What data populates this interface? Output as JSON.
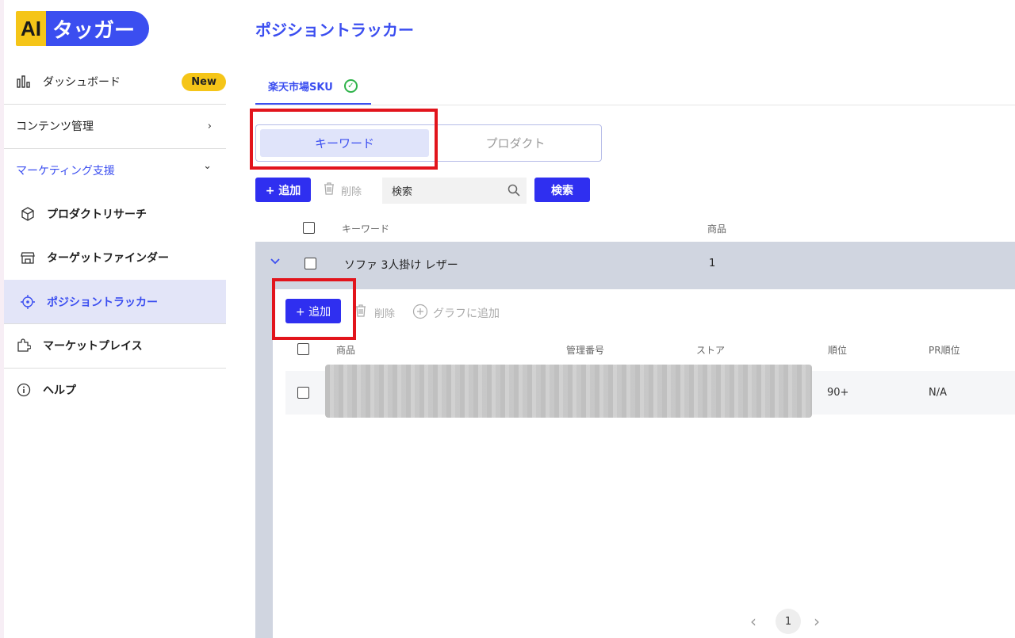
{
  "brand": {
    "ai": "AI",
    "name": "タッガー"
  },
  "sidebar": {
    "items": [
      {
        "label": "ダッシュボード",
        "badge": "New",
        "icon": "bar-chart-icon"
      },
      {
        "label": "コンテンツ管理",
        "chevron": "›"
      },
      {
        "label": "マーケティング支援",
        "chevron": "⌄"
      },
      {
        "label": "プロダクトリサーチ",
        "icon": "box-icon"
      },
      {
        "label": "ターゲットファインダー",
        "icon": "store-icon"
      },
      {
        "label": "ポジショントラッカー",
        "icon": "target-icon",
        "active": true
      },
      {
        "label": "マーケットプレイス",
        "icon": "puzzle-icon"
      },
      {
        "label": "ヘルプ",
        "icon": "info-icon"
      }
    ]
  },
  "main": {
    "title": "ポジショントラッカー",
    "tab_label": "楽天市場SKU",
    "segments": {
      "keyword": "キーワード",
      "product": "プロダクト"
    },
    "toolbar": {
      "add": "+ 追加",
      "delete": "削除",
      "search_value": "検索",
      "search_button": "検索"
    },
    "table": {
      "headers": {
        "keyword": "キーワード",
        "products": "商品"
      },
      "rows": [
        {
          "keyword": "ソファ 3人掛け レザー",
          "count": "1"
        }
      ]
    },
    "inner": {
      "toolbar": {
        "add": "+ 追加",
        "delete": "削除",
        "add_graph": "グラフに追加"
      },
      "headers": {
        "product": "商品",
        "mgmt": "管理番号",
        "store": "ストア",
        "rank": "順位",
        "pr_rank": "PR順位"
      },
      "rows": [
        {
          "rank": "90+",
          "pr_rank": "N/A"
        }
      ]
    },
    "pager": {
      "prev": "‹",
      "page": "1",
      "next": "›"
    }
  },
  "colors": {
    "accent": "#3b4ef0",
    "primary_button": "#2f2ff0",
    "highlight": "#e2141c",
    "badge": "#f5c518"
  }
}
